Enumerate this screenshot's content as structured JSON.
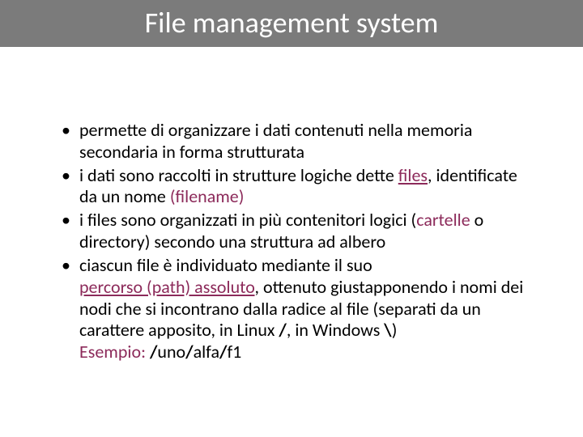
{
  "title": "File management system",
  "bullets": {
    "b1": "permette di organizzare i dati contenuti nella memoria secondaria in forma strutturata",
    "b2a": "i dati sono raccolti in strutture logiche dette ",
    "b2_files": "files",
    "b2b": ", identificate da un nome ",
    "b2_filename": "(filename)",
    "b3a": "i files sono organizzati in più contenitori logici (",
    "b3_cartelle": "cartelle",
    "b3b": " o directory) secondo una struttura ad albero",
    "b4a": "ciascun file è individuato mediante il suo ",
    "b4_path": "percorso (path) assoluto",
    "b4b": ", ottenuto giustapponendo i nomi dei nodi che si incontrano dalla radice al file (separati da un carattere apposito, in Linux ",
    "b4_slash": "/",
    "b4c": ", in Windows ",
    "b4_bslash": "\\",
    "b4d": ")",
    "b4_esempio": "Esempio:",
    "b4_ex_sep1": "/",
    "b4_ex_uno": "uno",
    "b4_ex_sep2": "/",
    "b4_ex_alfa": "alfa",
    "b4_ex_sep3": "/",
    "b4_ex_f1": "f1"
  }
}
